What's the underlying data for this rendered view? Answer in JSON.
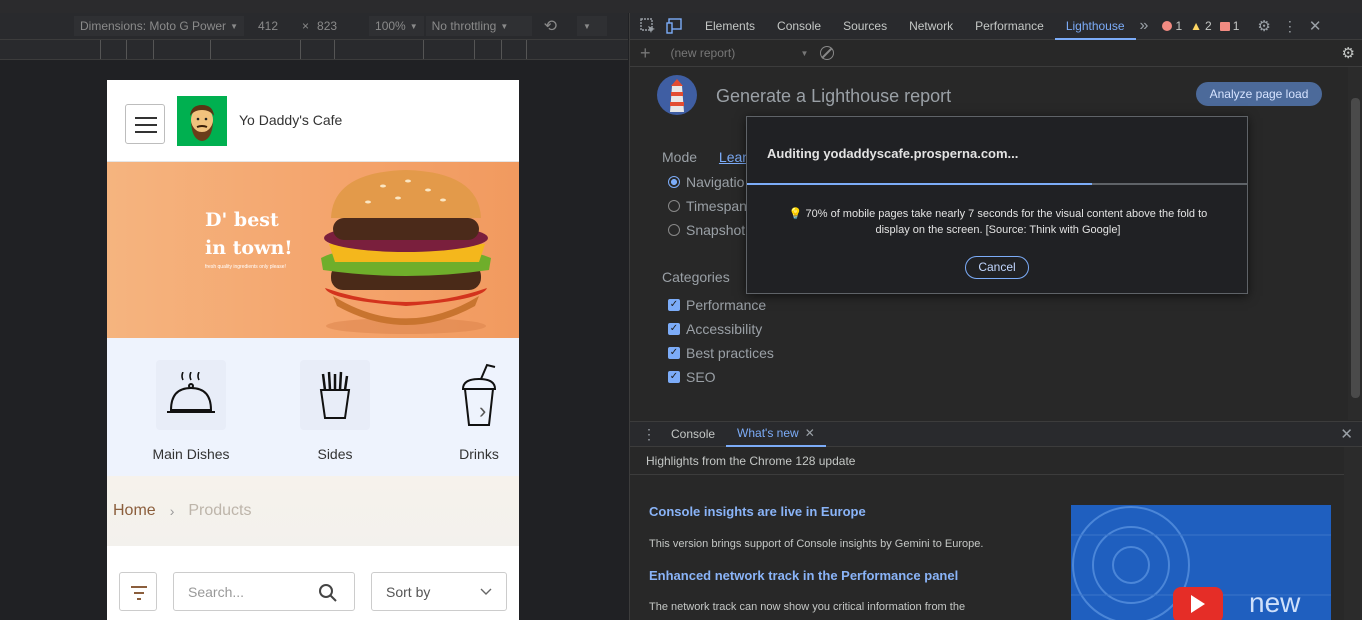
{
  "device_toolbar": {
    "dimensions_label": "Dimensions: Moto G Power",
    "width": "412",
    "times": "×",
    "height": "823",
    "zoom": "100%",
    "throttling": "No throttling"
  },
  "phone": {
    "cafe_name": "Yo Daddy's Cafe",
    "hero": {
      "title_line1": "D' best",
      "title_line2": "in town!",
      "subtitle": "fresh quality ingredients only please!"
    },
    "categories": [
      {
        "label": "Main Dishes"
      },
      {
        "label": "Sides"
      },
      {
        "label": "Drinks"
      }
    ],
    "breadcrumb": {
      "home": "Home",
      "separator": "›",
      "current": "Products"
    },
    "search_placeholder": "Search...",
    "sort_label": "Sort by"
  },
  "devtools": {
    "tabs": [
      "Elements",
      "Console",
      "Sources",
      "Network",
      "Performance",
      "Lighthouse"
    ],
    "active_tab": "Lighthouse",
    "more": "»",
    "badges": {
      "errors": "1",
      "warnings": "2",
      "issues": "1"
    },
    "report_select": "(new report)",
    "lighthouse": {
      "title": "Generate a Lighthouse report",
      "analyze_button": "Analyze page load",
      "mode_label": "Mode",
      "learn_more": "Lear",
      "modes": [
        "Navigatio",
        "Timespan",
        "Snapshot"
      ],
      "categories_label": "Categories",
      "categories": [
        "Performance",
        "Accessibility",
        "Best practices",
        "SEO"
      ]
    },
    "modal": {
      "title": "Auditing yodaddyscafe.prosperna.com...",
      "progress": 0.69,
      "tip_line1": "70% of mobile pages take nearly 7 seconds for the visual content above the fold to",
      "tip_line2": "display on the screen. [Source: Think with Google]",
      "cancel": "Cancel"
    },
    "drawer": {
      "tabs": [
        "Console",
        "What's new"
      ],
      "highlights": "Highlights from the Chrome 128 update",
      "news": [
        {
          "title": "Console insights are live in Europe",
          "body": "This version brings support of Console insights by Gemini to Europe."
        },
        {
          "title": "Enhanced network track in the Performance panel",
          "body": "The network track can now show you critical information from the"
        }
      ],
      "image_text": "new"
    }
  },
  "colors": {
    "accent": "#7cacf8",
    "lighthouse_button": "#4c6a9a",
    "error": "#f28b82",
    "warning": "#fdd663"
  }
}
